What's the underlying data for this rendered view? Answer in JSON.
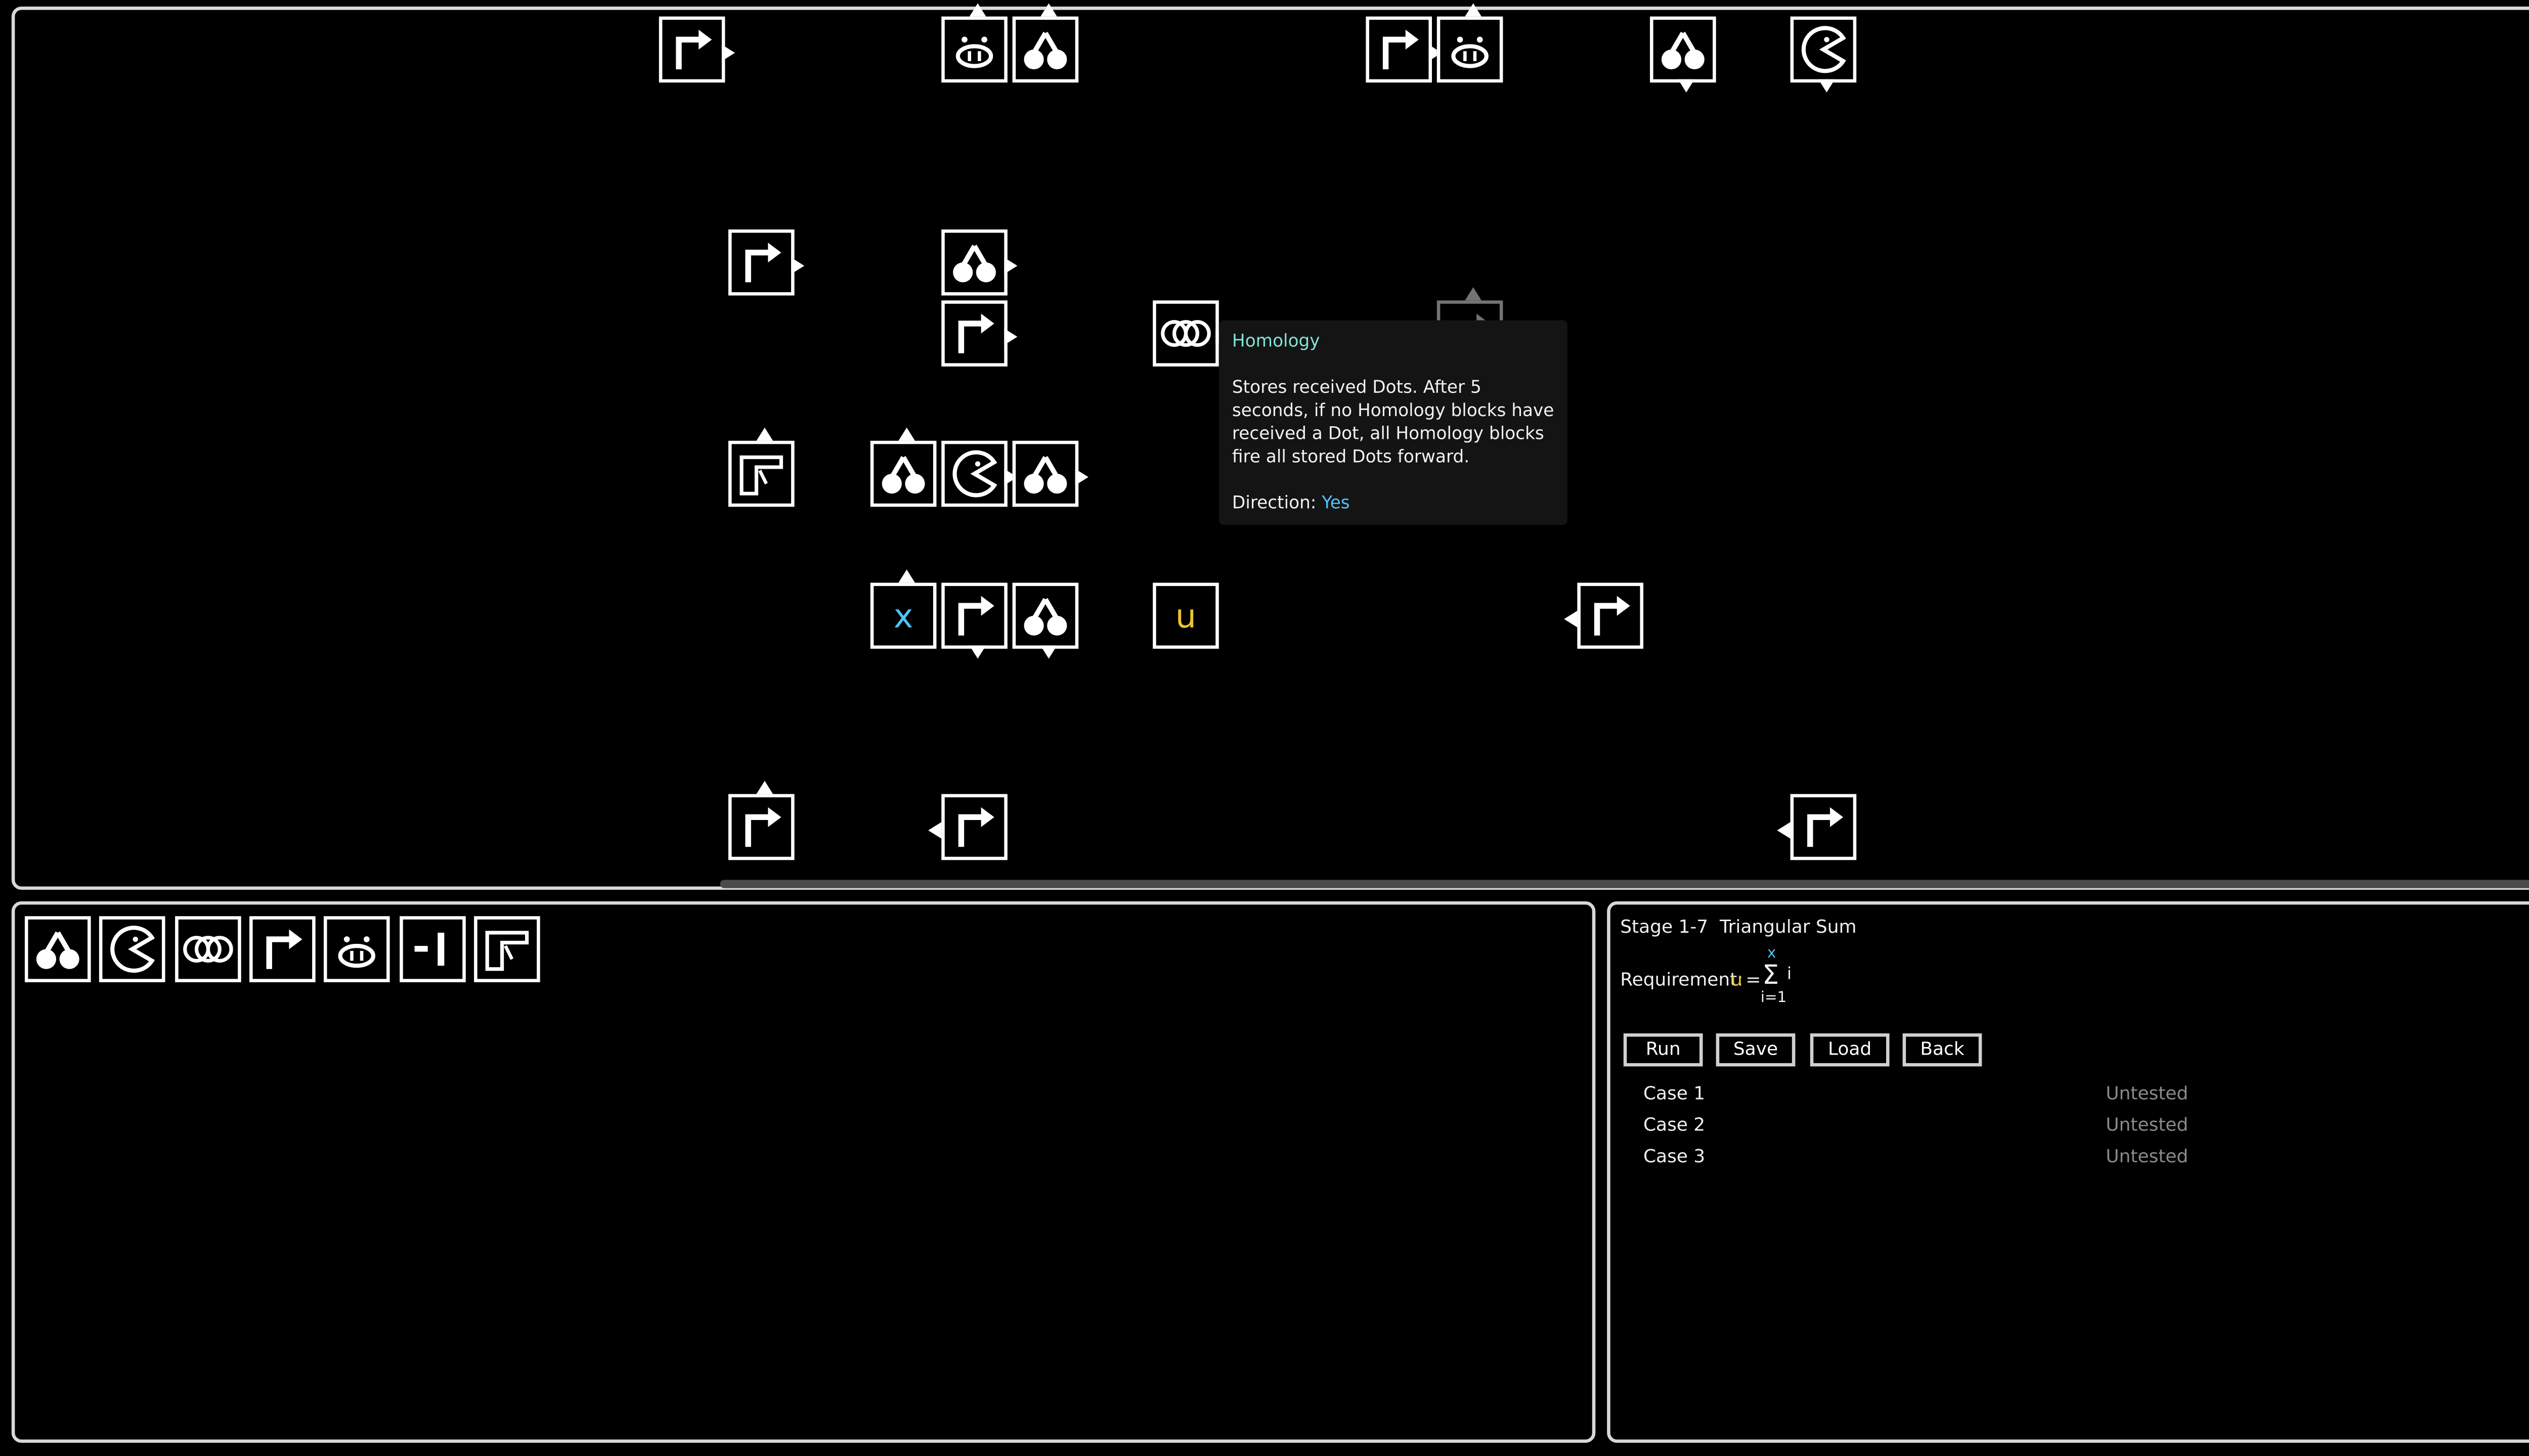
{
  "colors": {
    "accent_cyan": "#4fc3f7",
    "accent_yellow": "#e8c531",
    "tooltip_title": "#7fe3d6",
    "status_gray": "#8a8a8a"
  },
  "board": {
    "blocks": [
      {
        "kind": "turn",
        "col": 0,
        "row": 0,
        "dir": "right"
      },
      {
        "kind": "pig",
        "col": 0,
        "row": 0,
        "dir": "up"
      }
    ],
    "variable_x": "x",
    "variable_u": "u"
  },
  "tooltip": {
    "title": "Homology",
    "body": "Stores received Dots. After 5 seconds, if no Homology blocks have received a Dot, all Homology blocks fire all stored Dots forward.",
    "direction_label": "Direction:",
    "direction_value": "Yes"
  },
  "palette": {
    "items": [
      "split-icon",
      "pacman-icon",
      "homology-icon",
      "turn-icon",
      "pig-icon",
      "bar-icon",
      "gun-icon"
    ]
  },
  "info": {
    "stage": "Stage 1-7",
    "title": "Triangular Sum",
    "requirement_label": "Requirement:",
    "req_var": "u",
    "req_eq": "=",
    "sum_upper": "x",
    "sum_symbol": "Σ",
    "sum_term": "i",
    "sum_lower": "i=1",
    "buttons": {
      "run": "Run",
      "save": "Save",
      "load": "Load",
      "back": "Back"
    },
    "cases": [
      {
        "label": "Case 1",
        "status": "Untested"
      },
      {
        "label": "Case 2",
        "status": "Untested"
      },
      {
        "label": "Case 3",
        "status": "Untested"
      }
    ]
  }
}
